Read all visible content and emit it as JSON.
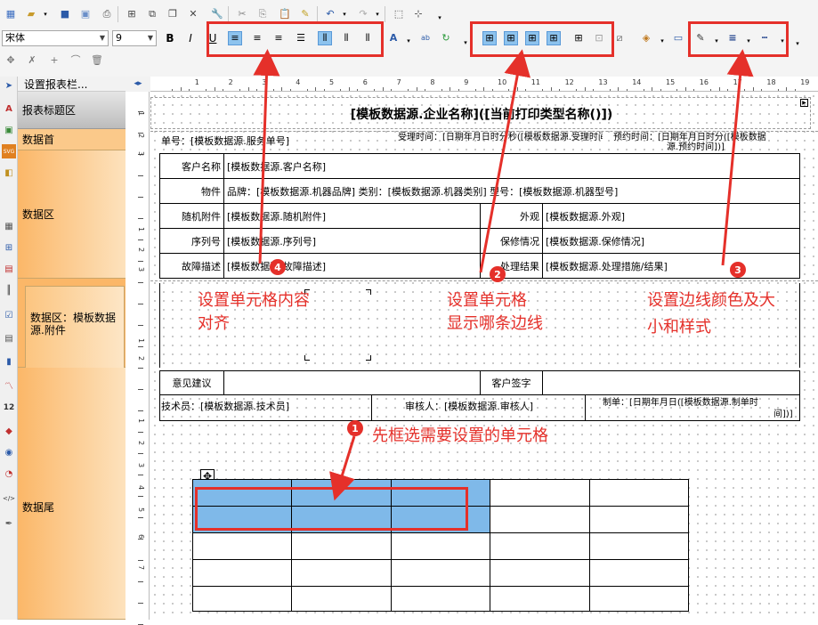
{
  "toolbar": {
    "font_name": "宋体",
    "font_size": "9",
    "bold": "B",
    "italic": "I",
    "underline": "U"
  },
  "left_tabs": {
    "property_bar": "设置报表栏..."
  },
  "bands": [
    {
      "label": "报表标题区"
    },
    {
      "label": "数据首"
    },
    {
      "label": "数据区"
    },
    {
      "label": "数据区：模板数据源.附件"
    },
    {
      "label": "数据尾"
    }
  ],
  "ruler": {
    "marks": [
      "1",
      "2",
      "3",
      "4",
      "5",
      "6",
      "7",
      "8",
      "9",
      "10",
      "11",
      "12",
      "13",
      "14",
      "15",
      "16",
      "17",
      "18",
      "19"
    ],
    "vmarks": [
      "1",
      "2",
      "3",
      "1",
      "2",
      "3",
      "1",
      "2",
      "1",
      "2",
      "3",
      "4",
      "5",
      "6",
      "7"
    ]
  },
  "report": {
    "title": "[模板数据源.企业名称]([当前打印类型名称()])",
    "order_no": "单号：[模板数据源.服务单号]",
    "accept_time": "受理时间：[日期年月日时分秒([模板数据源.受理时间])]",
    "appoint_time": "预约时间：[日期年月日时分([模板数据",
    "appoint_time2": "源.预约时间])]",
    "rows": [
      {
        "l1": "客户名称",
        "v1": "[模板数据源.客户名称]"
      },
      {
        "l1": "物件",
        "v1": "品牌：[模板数据源.机器品牌] 类别：[模板数据源.机器类别] 型号：[模板数据源.机器型号]"
      },
      {
        "l1": "随机附件",
        "v1": "[模板数据源.随机附件]",
        "l2": "外观",
        "v2": "[模板数据源.外观]"
      },
      {
        "l1": "序列号",
        "v1": "[模板数据源.序列号]",
        "l2": "保修情况",
        "v2": "[模板数据源.保修情况]"
      },
      {
        "l1": "故障描述",
        "v1": "[模板数据源.故障描述]",
        "l2": "处理结果",
        "v2": "[模板数据源.处理措施/结果]"
      }
    ],
    "opinion": "意见建议",
    "customer_sign": "客户签字",
    "technician": "技术员：[模板数据源.技术员]",
    "reviewer": "审核人：[模板数据源.审核人]",
    "made_by": "制单：[日期年月日([模板数据源.制单时",
    "made_by2": "间])]"
  },
  "annotations": {
    "a1": "先框选需要设置的单元格",
    "a2_line1": "设置单元格",
    "a2_line2": "显示哪条边线",
    "a3_line1": "设置边线颜色及大",
    "a3_line2": "小和样式",
    "a4_line1": "设置单元格内容",
    "a4_line2": "对齐",
    "n1": "1",
    "n2": "2",
    "n3": "3",
    "n4": "4"
  },
  "colors": {
    "annotation": "#e5302a",
    "selection": "#7fb9e9",
    "band": "#fbb768"
  }
}
